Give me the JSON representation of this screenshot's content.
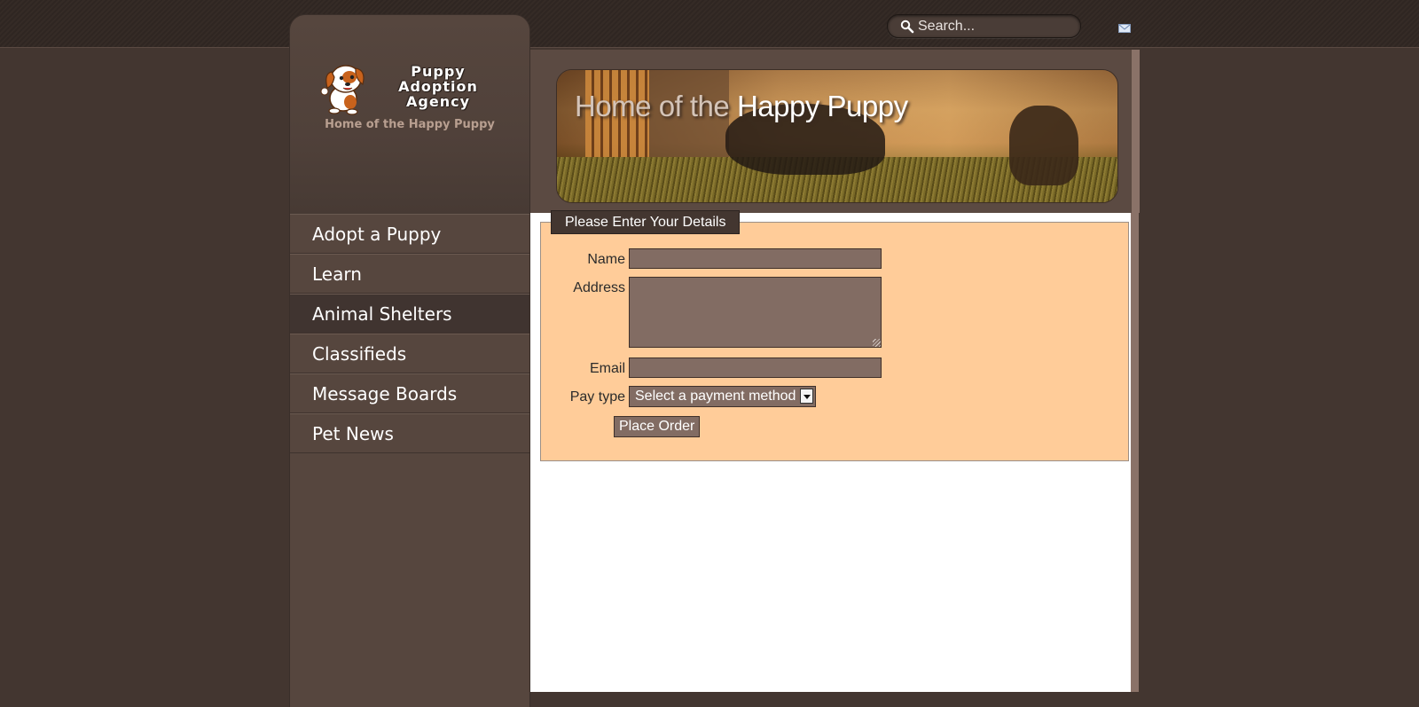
{
  "search": {
    "placeholder": "Search..."
  },
  "brand": {
    "name_line1": "Puppy",
    "name_line2": "Adoption",
    "name_line3": "Agency",
    "tagline": "Home of the Happy Puppy"
  },
  "nav": {
    "items": [
      {
        "label": "Adopt a Puppy"
      },
      {
        "label": "Learn"
      },
      {
        "label": "Animal Shelters"
      },
      {
        "label": "Classifieds"
      },
      {
        "label": "Message Boards"
      },
      {
        "label": "Pet News"
      }
    ],
    "active": "Animal Shelters"
  },
  "banner": {
    "title_prefix": "Home of the",
    "title_highlight": "Happy Puppy"
  },
  "form": {
    "legend": "Please Enter Your Details",
    "name_label": "Name",
    "name_value": "",
    "address_label": "Address",
    "address_value": "",
    "email_label": "Email",
    "email_value": "",
    "paytype_label": "Pay type",
    "paytype_selected": "Select a payment method",
    "submit_label": "Place Order"
  },
  "colors": {
    "page_bg": "#433630",
    "sidebar_bg": "#56463e",
    "form_bg": "#ffcc99",
    "field_bg": "#826c63"
  },
  "icons": [
    "search-icon",
    "mail-icon",
    "puppy-logo"
  ]
}
